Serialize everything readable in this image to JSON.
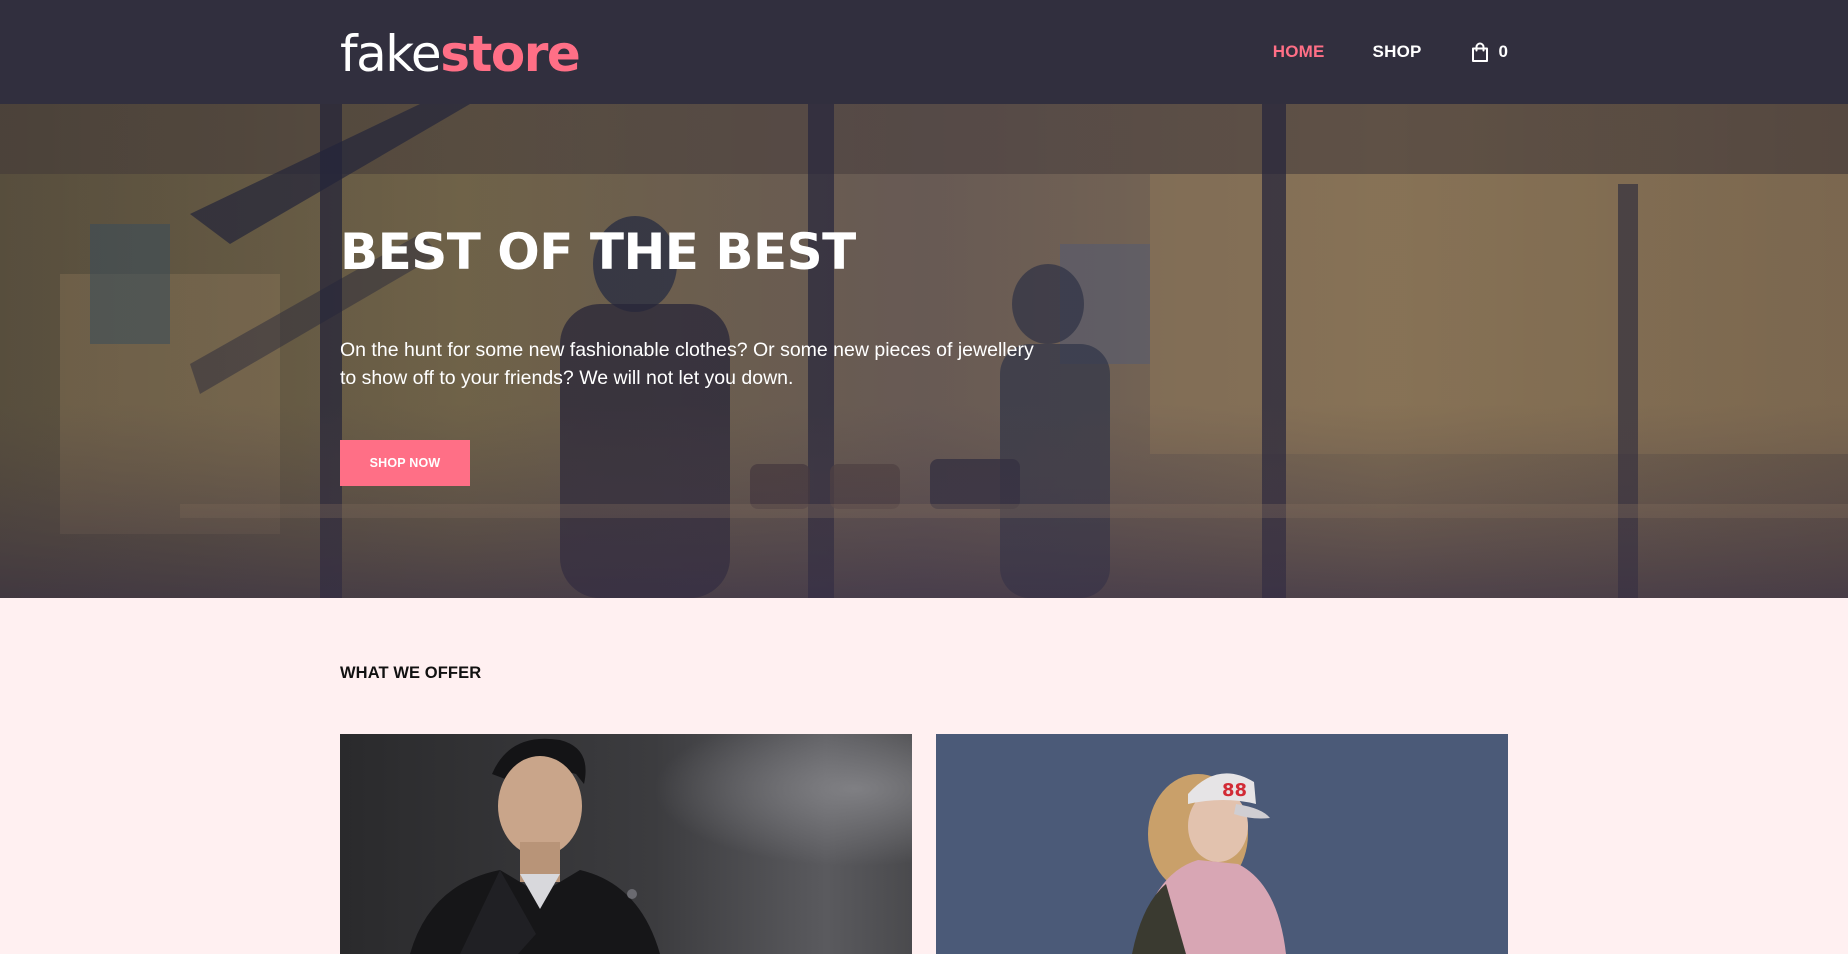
{
  "header": {
    "logo": {
      "part1": "fake",
      "part2": "store"
    },
    "nav": [
      {
        "label": "HOME",
        "active": true
      },
      {
        "label": "SHOP",
        "active": false
      }
    ],
    "cart": {
      "icon": "shopping-bag-icon",
      "count": "0"
    }
  },
  "hero": {
    "title": "BEST OF THE BEST",
    "text": "On the hunt for some new fashionable clothes? Or some new pieces of jewellery to show off to your friends? We will not let you down.",
    "button_label": "SHOP NOW"
  },
  "offer": {
    "title": "WHAT WE OFFER",
    "cards": [
      {
        "image": "man-leather-jacket-photo"
      },
      {
        "image": "woman-cap-photo"
      }
    ]
  },
  "colors": {
    "header_bg": "#312f3e",
    "accent": "#ff6f86",
    "page_bg": "#fff0f1",
    "text_dark": "#111111"
  }
}
